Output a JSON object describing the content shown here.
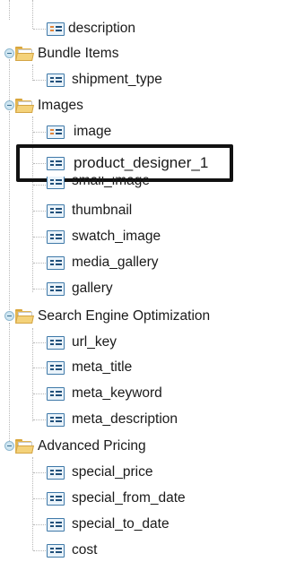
{
  "tree": {
    "items": [
      {
        "label": "description",
        "type": "field",
        "icon": "field-icon"
      },
      {
        "label": "Bundle Items",
        "type": "group",
        "icon": "folder-icon"
      },
      {
        "label": "shipment_type",
        "type": "field",
        "icon": "field-icon"
      },
      {
        "label": "Images",
        "type": "group",
        "icon": "folder-icon"
      },
      {
        "label": "image",
        "type": "field",
        "icon": "field-icon"
      },
      {
        "label": "product_designer_1",
        "type": "field",
        "icon": "field-icon",
        "highlighted": true
      },
      {
        "label": "small_image",
        "type": "field",
        "icon": "field-icon"
      },
      {
        "label": "thumbnail",
        "type": "field",
        "icon": "field-icon"
      },
      {
        "label": "swatch_image",
        "type": "field",
        "icon": "field-icon"
      },
      {
        "label": "media_gallery",
        "type": "field",
        "icon": "field-icon"
      },
      {
        "label": "gallery",
        "type": "field",
        "icon": "field-icon"
      },
      {
        "label": "Search Engine Optimization",
        "type": "group",
        "icon": "folder-icon"
      },
      {
        "label": "url_key",
        "type": "field",
        "icon": "field-icon"
      },
      {
        "label": "meta_title",
        "type": "field",
        "icon": "field-icon"
      },
      {
        "label": "meta_keyword",
        "type": "field",
        "icon": "field-icon"
      },
      {
        "label": "meta_description",
        "type": "field",
        "icon": "field-icon"
      },
      {
        "label": "Advanced Pricing",
        "type": "group",
        "icon": "folder-icon"
      },
      {
        "label": "special_price",
        "type": "field",
        "icon": "field-icon"
      },
      {
        "label": "special_from_date",
        "type": "field",
        "icon": "field-icon"
      },
      {
        "label": "special_to_date",
        "type": "field",
        "icon": "field-icon"
      },
      {
        "label": "cost",
        "type": "field",
        "icon": "field-icon"
      }
    ]
  },
  "colors": {
    "folder": "#e2b552",
    "field_border": "#3f79a8",
    "highlight_border": "#111111"
  }
}
